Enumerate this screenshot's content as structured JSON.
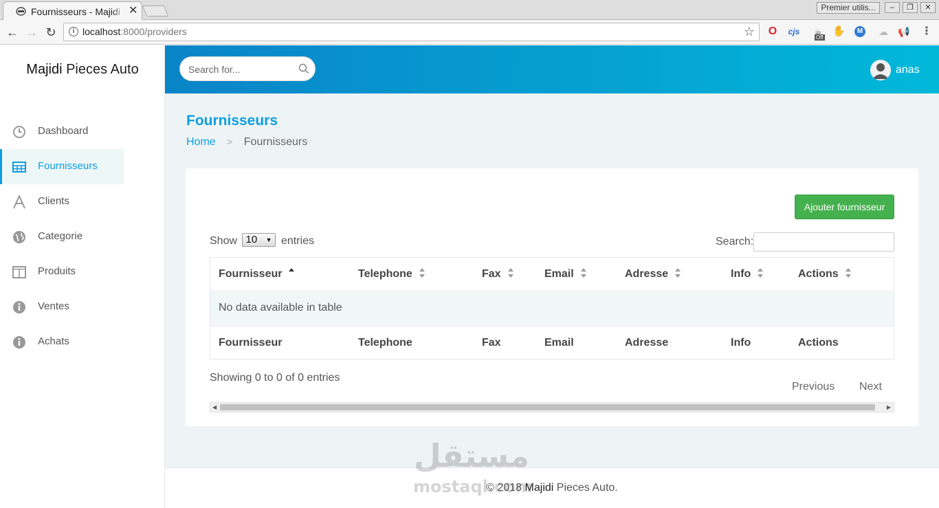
{
  "browser": {
    "tab_title": "Fournisseurs - Majidi Pieces Auto",
    "url_host": "localhost",
    "url_path": ":8000/providers",
    "profile_label": "Premier utilis...",
    "ext_cjs": "cjs",
    "ext_off_badge": "Off"
  },
  "app": {
    "brand_name": "Majidi",
    "brand_rest": "Pieces Auto",
    "search_placeholder": "Search for...",
    "user_name": "anas"
  },
  "sidebar": {
    "items": [
      {
        "label": "Dashboard",
        "icon": "clock-icon",
        "active": false
      },
      {
        "label": "Fournisseurs",
        "icon": "table-icon",
        "active": true
      },
      {
        "label": "Clients",
        "icon": "font-icon",
        "active": false
      },
      {
        "label": "Categorie",
        "icon": "globe-icon",
        "active": false
      },
      {
        "label": "Produits",
        "icon": "columns-icon",
        "active": false
      },
      {
        "label": "Ventes",
        "icon": "info-icon",
        "active": false
      },
      {
        "label": "Achats",
        "icon": "info-icon",
        "active": false
      }
    ]
  },
  "page": {
    "title": "Fournisseurs",
    "breadcrumb": {
      "home": "Home",
      "current": "Fournisseurs"
    },
    "add_button": "Ajouter fournisseur"
  },
  "table": {
    "show_label": "Show",
    "page_length": "10",
    "entries_label": "entries",
    "search_label": "Search:",
    "columns": [
      "Fournisseur",
      "Telephone",
      "Fax",
      "Email",
      "Adresse",
      "Info",
      "Actions"
    ],
    "sorted_column": "Fournisseur",
    "empty_message": "No data available in table",
    "info": "Showing 0 to 0 of 0 entries",
    "previous": "Previous",
    "next": "Next"
  },
  "footer": {
    "prefix": "© 2018",
    "brand": "Majidi",
    "suffix": "Pieces Auto."
  },
  "watermark": {
    "arabic": "مستقل",
    "latin": "mostaql.com"
  },
  "colors": {
    "accent": "#0e9de0",
    "header_gradient_start": "#0a84c8",
    "header_gradient_end": "#01b8d9",
    "success": "#45b14e",
    "page_bg": "#eef4f5"
  }
}
